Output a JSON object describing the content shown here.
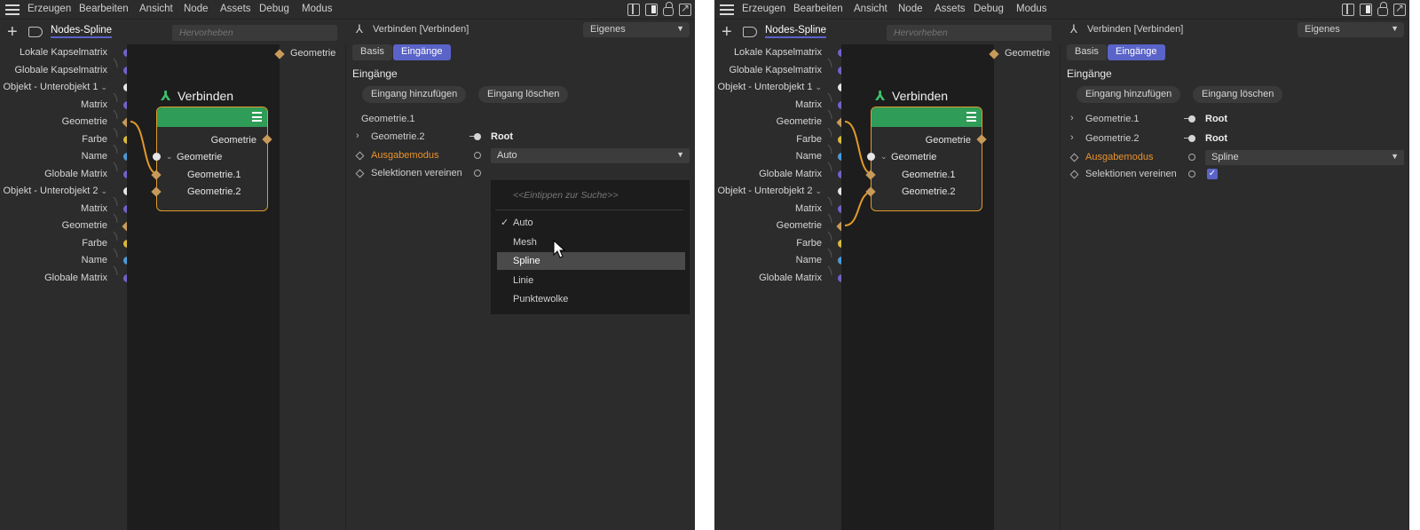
{
  "menu": {
    "items": [
      "Erzeugen",
      "Bearbeiten",
      "Ansicht",
      "Node",
      "Assets",
      "Debug",
      "Modus"
    ]
  },
  "toolbar": {
    "tab_label": "Nodes-Spline",
    "search_placeholder": "Hervorheben"
  },
  "ports": {
    "items": [
      {
        "label": "Lokale Kapselmatrix",
        "color": "#6f63c9",
        "shape": "circle",
        "chev": ""
      },
      {
        "label": "Globale Kapselmatrix",
        "color": "#6f63c9",
        "shape": "circle",
        "chev": ""
      },
      {
        "label": "Objekt - Unterobjekt 1",
        "color": "#e6e6e6",
        "shape": "circle",
        "chev": "⌄"
      },
      {
        "label": "Matrix",
        "color": "#6f63c9",
        "shape": "circle",
        "chev": ""
      },
      {
        "label": "Geometrie",
        "color": "#c79a5a",
        "shape": "diamond",
        "chev": ""
      },
      {
        "label": "Farbe",
        "color": "#d9b93a",
        "shape": "circle",
        "chev": ""
      },
      {
        "label": "Name",
        "color": "#4a9ad6",
        "shape": "circle",
        "chev": ""
      },
      {
        "label": "Globale Matrix",
        "color": "#6f63c9",
        "shape": "circle",
        "chev": ""
      },
      {
        "label": "Objekt - Unterobjekt 2",
        "color": "#e6e6e6",
        "shape": "circle",
        "chev": "⌄"
      },
      {
        "label": "Matrix",
        "color": "#6f63c9",
        "shape": "circle",
        "chev": ""
      },
      {
        "label": "Geometrie",
        "color": "#c79a5a",
        "shape": "diamond",
        "chev": ""
      },
      {
        "label": "Farbe",
        "color": "#d9b93a",
        "shape": "circle",
        "chev": ""
      },
      {
        "label": "Name",
        "color": "#4a9ad6",
        "shape": "circle",
        "chev": ""
      },
      {
        "label": "Globale Matrix",
        "color": "#6f63c9",
        "shape": "circle",
        "chev": ""
      }
    ]
  },
  "output": {
    "label": "Geometrie"
  },
  "node": {
    "title": "Verbinden",
    "output_label": "Geometrie",
    "group_label": "Geometrie",
    "input1_label": "Geometrie.1",
    "input2_label": "Geometrie.2"
  },
  "inspector": {
    "title": "Verbinden [Verbinden]",
    "mode_dropdown": "Eigenes",
    "tab_basis": "Basis",
    "tab_eingaenge": "Eingänge",
    "section_title": "Eingänge",
    "add_input_button": "Eingang hinzufügen",
    "delete_input_button": "Eingang löschen"
  },
  "left_inspector": {
    "row_geometrie1_label": "Geometrie.1",
    "row_geometrie2_label": "Geometrie.2",
    "row_geometrie2_value": "Root",
    "row_ausgabemodus_label": "Ausgabemodus",
    "row_ausgabemodus_value": "Auto",
    "row_selektionen_label": "Selektionen vereinen",
    "popup": {
      "search_hint": "<<Eintippen zur Suche>>",
      "options": [
        "Auto",
        "Mesh",
        "Spline",
        "Linie",
        "Punktewolke"
      ],
      "checked": "Auto",
      "hovered": "Spline"
    }
  },
  "right_inspector": {
    "row_geometrie1_label": "Geometrie.1",
    "row_geometrie1_value": "Root",
    "row_geometrie2_label": "Geometrie.2",
    "row_geometrie2_value": "Root",
    "row_ausgabemodus_label": "Ausgabemodus",
    "row_ausgabemodus_value": "Spline",
    "row_selektionen_label": "Selektionen vereinen",
    "selektionen_checked": true
  },
  "colors": {
    "accent": "#5a63c8",
    "node_header": "#2f9c57",
    "node_border": "#e09a2a",
    "orange_label": "#e8922f"
  }
}
